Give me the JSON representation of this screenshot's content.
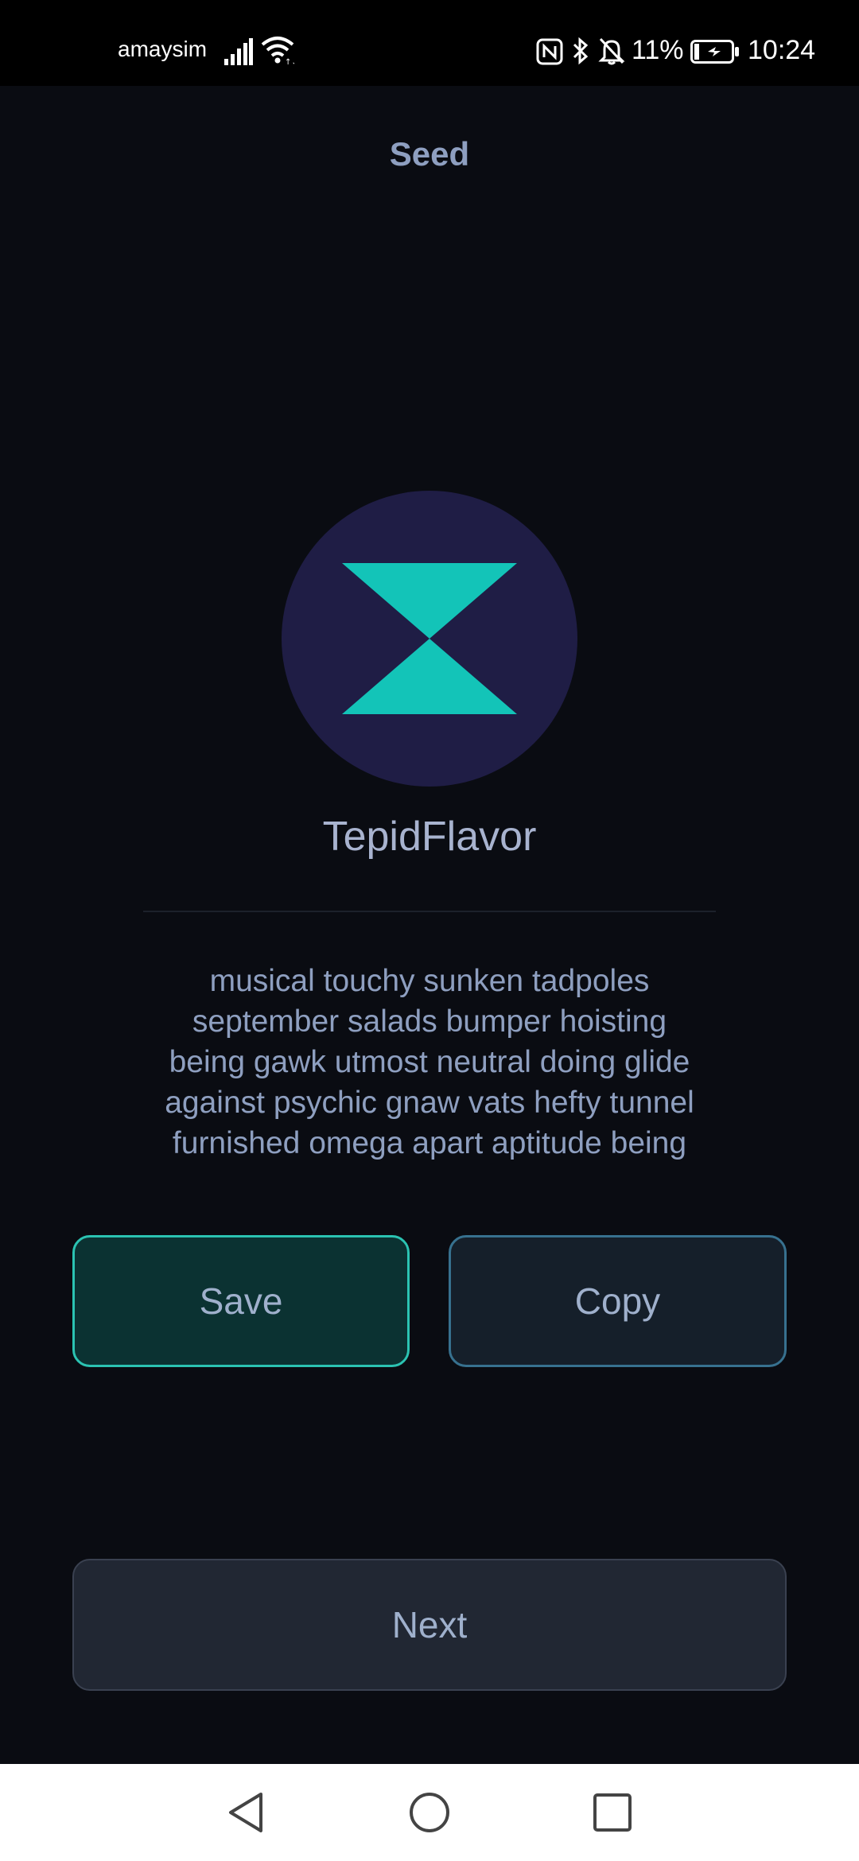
{
  "status_bar": {
    "carrier": "amaysim",
    "battery_percent": "11%",
    "time": "10:24",
    "icons": [
      "signal-icon",
      "wifi-icon",
      "nfc-icon",
      "bluetooth-icon",
      "mute-icon",
      "battery-charging-icon"
    ]
  },
  "header": {
    "title": "Seed"
  },
  "account": {
    "avatar_icon": "hourglass-logo-icon",
    "avatar_bg": "#1f1d45",
    "avatar_fg": "#13c4b8",
    "name": "TepidFlavor"
  },
  "seed": {
    "lines": [
      "musical touchy sunken tadpoles",
      "september salads bumper hoisting",
      "being gawk utmost neutral doing glide",
      "against psychic gnaw vats hefty tunnel",
      "furnished omega apart aptitude being"
    ]
  },
  "actions": {
    "save_label": "Save",
    "copy_label": "Copy",
    "next_label": "Next"
  },
  "nav_bar": {
    "icons": [
      "back-icon",
      "home-icon",
      "recents-icon"
    ]
  },
  "colors": {
    "background": "#0a0c12",
    "accent_teal": "#2bc3b2",
    "accent_blue": "#37718f",
    "text": "#8e9fc0"
  }
}
